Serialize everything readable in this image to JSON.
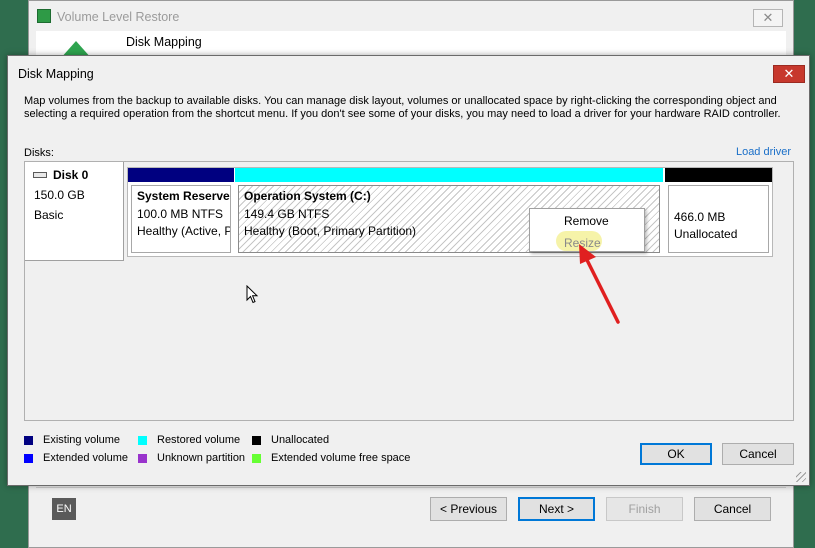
{
  "wizard": {
    "title": "Volume Level Restore",
    "close_glyph": "✕",
    "step_title": "Disk Mapping",
    "language": "EN",
    "buttons": {
      "previous": "< Previous",
      "next": "Next >",
      "finish": "Finish",
      "cancel": "Cancel"
    }
  },
  "dialog": {
    "title": "Disk Mapping",
    "close_glyph": "✕",
    "description": "Map volumes from the backup to available disks. You can manage disk layout, volumes or unallocated space by right-clicking the corresponding object and selecting a required operation from the shortcut menu. If you don't see some of your disks, you may need to load a driver for your hardware RAID controller.",
    "disks_label": "Disks:",
    "load_driver": "Load driver",
    "disk": {
      "name": "Disk 0",
      "size": "150.0 GB",
      "type": "Basic"
    },
    "partitions": [
      {
        "name": "System Reserve",
        "size": "100.0 MB NTFS",
        "status": "Healthy (Active, P",
        "color": "#000080"
      },
      {
        "name": "Operation System (C:)",
        "size": "149.4 GB NTFS",
        "status": "Healthy (Boot, Primary Partition)",
        "color": "#00ffff"
      },
      {
        "name": "",
        "size": "466.0 MB",
        "status": "Unallocated",
        "color": "#000000"
      }
    ],
    "context_menu": {
      "items": [
        "Remove",
        "Resize"
      ],
      "highlighted": "Resize"
    },
    "legend": [
      {
        "label": "Existing volume",
        "color": "#000080"
      },
      {
        "label": "Restored volume",
        "color": "#00ffff"
      },
      {
        "label": "Unallocated",
        "color": "#000000"
      },
      {
        "label": "Extended volume",
        "color": "#0000ff"
      },
      {
        "label": "Unknown partition",
        "color": "#9933cc"
      },
      {
        "label": "Extended volume free space",
        "color": "#66ff33"
      }
    ],
    "buttons": {
      "ok": "OK",
      "cancel": "Cancel"
    }
  },
  "colors": {
    "annotation_arrow": "#e02020",
    "highlight": "#f5f2a0"
  }
}
